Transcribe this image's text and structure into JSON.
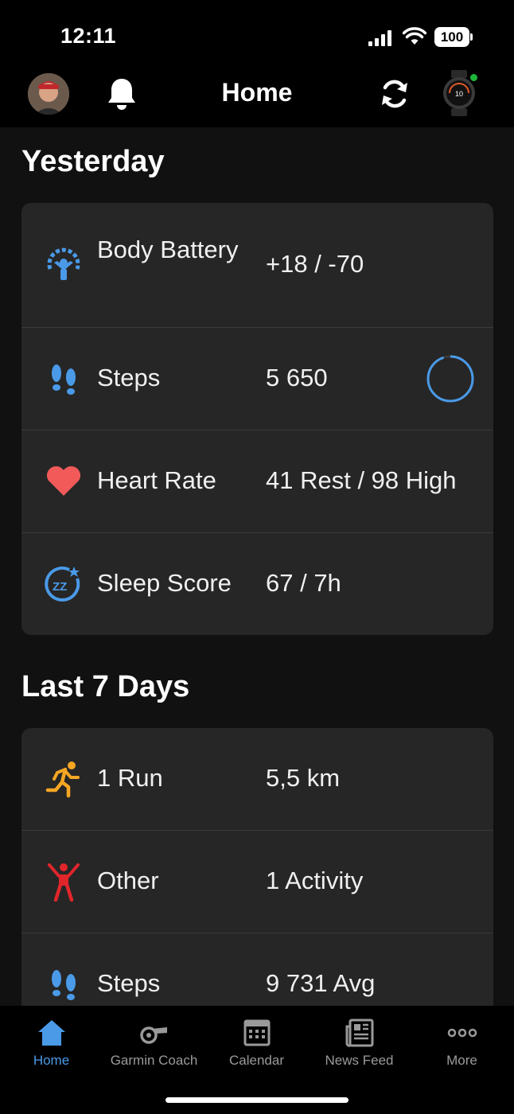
{
  "status": {
    "time": "12:11",
    "battery": "100"
  },
  "header": {
    "title": "Home"
  },
  "yesterday": {
    "title": "Yesterday",
    "rows": [
      {
        "label": "Body Battery",
        "value": "+18 / -70",
        "icon": "body-battery-icon",
        "color": "#4a9ae8"
      },
      {
        "label": "Steps",
        "value": "5 650",
        "icon": "footprints-icon",
        "color": "#4a9ae8",
        "progress": 0.95
      },
      {
        "label": "Heart Rate",
        "value": "41 Rest / 98 High",
        "icon": "heart-icon",
        "color": "#f25a5a"
      },
      {
        "label": "Sleep Score",
        "value": "67 / 7h",
        "icon": "sleep-icon",
        "color": "#4a9ae8"
      }
    ]
  },
  "last7": {
    "title": "Last 7 Days",
    "rows": [
      {
        "label": "1 Run",
        "value": "5,5 km",
        "icon": "running-icon",
        "color": "#f5a623"
      },
      {
        "label": "Other",
        "value": "1 Activity",
        "icon": "person-jumping-icon",
        "color": "#e0262b"
      },
      {
        "label": "Steps",
        "value": "9 731 Avg",
        "icon": "footprints-icon",
        "color": "#4a9ae8"
      }
    ]
  },
  "tabs": [
    {
      "label": "Home",
      "icon": "home-icon",
      "active": true
    },
    {
      "label": "Garmin Coach",
      "icon": "whistle-icon",
      "active": false
    },
    {
      "label": "Calendar",
      "icon": "calendar-icon",
      "active": false
    },
    {
      "label": "News Feed",
      "icon": "newspaper-icon",
      "active": false
    },
    {
      "label": "More",
      "icon": "more-dots-icon",
      "active": false
    }
  ],
  "colors": {
    "accent": "#4a9ae8",
    "card": "#262626",
    "background": "#111111"
  }
}
